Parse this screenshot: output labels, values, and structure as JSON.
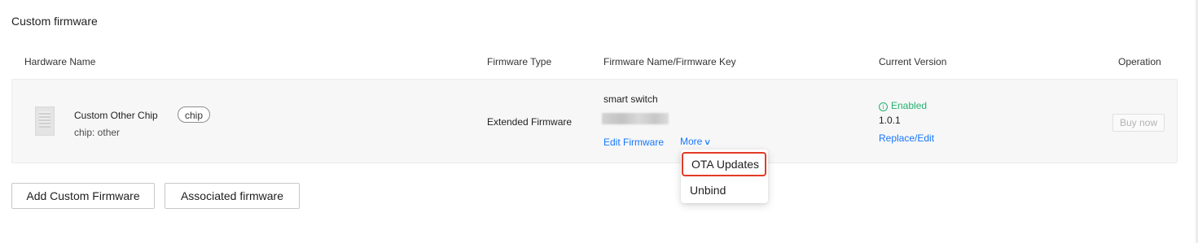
{
  "section": {
    "title": "Custom firmware"
  },
  "table": {
    "headers": {
      "hardware_name": "Hardware Name",
      "firmware_type": "Firmware Type",
      "firmware_name_key": "Firmware Name/Firmware Key",
      "current_version": "Current Version",
      "operation": "Operation"
    },
    "rows": [
      {
        "hardware_name": "Custom Other Chip",
        "hardware_tag": "chip",
        "hardware_sub": "chip: other",
        "firmware_type": "Extended Firmware",
        "firmware_name": "smart switch",
        "edit_firmware_link": "Edit Firmware",
        "more_label": "More",
        "status": "Enabled",
        "status_color": "#23b26d",
        "version": "1.0.1",
        "replace_link": "Replace/Edit",
        "operation_button": "Buy now"
      }
    ]
  },
  "more_menu": {
    "items": [
      {
        "label": "OTA Updates",
        "highlighted": true
      },
      {
        "label": "Unbind"
      }
    ],
    "highlight_color": "#e23b26"
  },
  "actions": {
    "add_custom_firmware": "Add Custom Firmware",
    "associated_firmware": "Associated firmware"
  },
  "colors": {
    "link": "#1677ff",
    "row_background": "#f7f7f8"
  },
  "icons": {
    "status_icon": "info-circle-icon",
    "more_chevron": "chevron-down-icon",
    "chip_thumbnail": "chip-image"
  }
}
